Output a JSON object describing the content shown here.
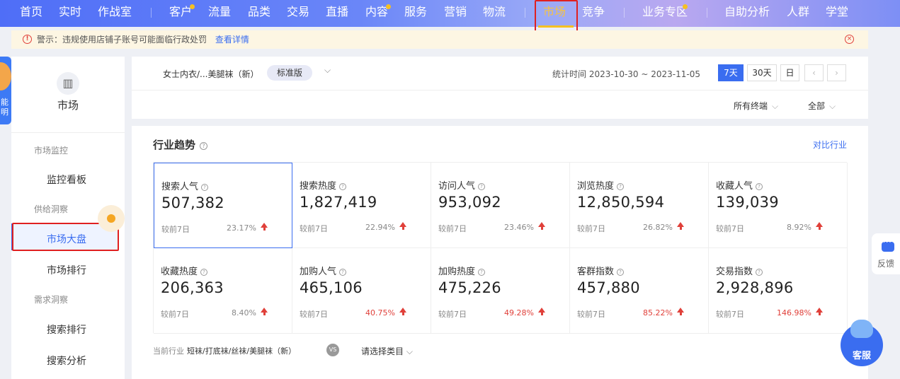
{
  "topnav": {
    "items": [
      "首页",
      "实时",
      "作战室",
      "客户",
      "流量",
      "品类",
      "交易",
      "直播",
      "内容",
      "服务",
      "营销",
      "物流",
      "市场",
      "竞争",
      "业务专区",
      "自助分析",
      "人群",
      "学堂"
    ],
    "active": "市场",
    "colors": {
      "accent": "#f5c022",
      "gradient_start": "#4f6ef7"
    }
  },
  "warning": {
    "text": "警示：违规使用店铺子账号可能面临行政处罚",
    "link": "查看详情"
  },
  "mascot": {
    "text": "能明"
  },
  "sidebar": {
    "title": "市场",
    "groups": [
      {
        "label": "市场监控",
        "items": [
          "监控看板"
        ]
      },
      {
        "label": "供给洞察",
        "items": [
          "市场大盘",
          "市场排行"
        ]
      },
      {
        "label": "需求洞察",
        "items": [
          "搜索排行",
          "搜索分析"
        ]
      }
    ],
    "active_item": "市场大盘"
  },
  "filter": {
    "category": "女士内衣/...美腿袜（新）",
    "edition": "标准版",
    "date_range": "统计时间 2023-10-30 ~ 2023-11-05",
    "period_buttons": [
      "7天",
      "30天",
      "日"
    ],
    "selected_period": "7天",
    "terminal": "所有终端",
    "scope": "全部"
  },
  "trend": {
    "heading": "行业趋势",
    "compare_link": "对比行业",
    "metrics": [
      {
        "label": "搜索人气",
        "value": "507,382",
        "compare": "较前7日",
        "change": "23.17%"
      },
      {
        "label": "搜索热度",
        "value": "1,827,419",
        "compare": "较前7日",
        "change": "22.94%"
      },
      {
        "label": "访问人气",
        "value": "953,092",
        "compare": "较前7日",
        "change": "23.46%"
      },
      {
        "label": "浏览热度",
        "value": "12,850,594",
        "compare": "较前7日",
        "change": "26.82%"
      },
      {
        "label": "收藏人气",
        "value": "139,039",
        "compare": "较前7日",
        "change": "8.92%"
      },
      {
        "label": "收藏热度",
        "value": "206,363",
        "compare": "较前7日",
        "change": "8.40%"
      },
      {
        "label": "加购人气",
        "value": "465,106",
        "compare": "较前7日",
        "change": "40.75%"
      },
      {
        "label": "加购热度",
        "value": "475,226",
        "compare": "较前7日",
        "change": "49.28%"
      },
      {
        "label": "客群指数",
        "value": "457,880",
        "compare": "较前7日",
        "change": "85.22%"
      },
      {
        "label": "交易指数",
        "value": "2,928,896",
        "compare": "较前7日",
        "change": "146.98%"
      }
    ],
    "current_industry_label": "当前行业",
    "current_industry_value": "短袜/打底袜/丝袜/美腿袜（新）",
    "vs": "VS",
    "pick_category": "请选择类目"
  },
  "widgets": {
    "feedback": "反馈",
    "service": "客服"
  }
}
